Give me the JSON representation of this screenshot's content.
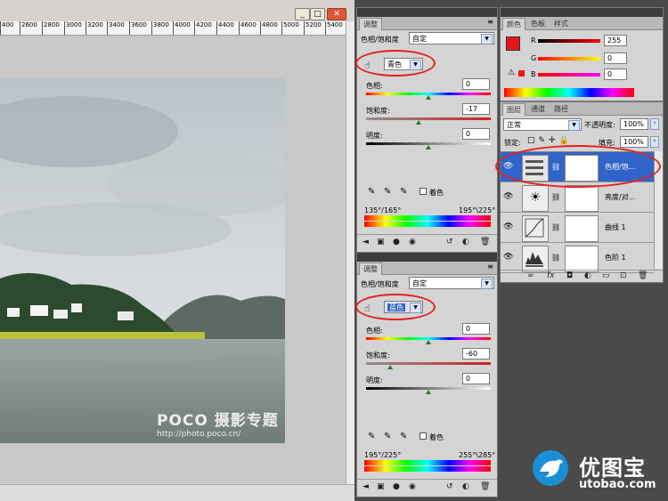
{
  "document": {
    "ruler_ticks": [
      "400",
      "2600",
      "2800",
      "3000",
      "3200",
      "3400",
      "3600",
      "3800",
      "4000",
      "4200",
      "4400",
      "4600",
      "4800",
      "5000",
      "5200",
      "5400"
    ],
    "window_buttons": [
      "_",
      "□",
      "✕"
    ],
    "watermark_brand": "POCO 摄影专题",
    "watermark_url": "http://photo.poco.cn/"
  },
  "adjust_panel_1": {
    "tab": "调整",
    "preset_label": "色相/饱和度",
    "preset_value": "自定",
    "channel": "青色",
    "hue_label": "色相:",
    "hue_value": "0",
    "sat_label": "饱和度:",
    "sat_value": "-17",
    "light_label": "明度:",
    "light_value": "0",
    "colorize_label": "着色",
    "range_left": "135°/165°",
    "range_right": "195°\\225°"
  },
  "adjust_panel_2": {
    "tab": "调整",
    "preset_label": "色相/饱和度",
    "preset_value": "自定",
    "channel": "蓝色",
    "hue_label": "色相:",
    "hue_value": "0",
    "sat_label": "饱和度:",
    "sat_value": "-60",
    "light_label": "明度:",
    "light_value": "0",
    "colorize_label": "着色",
    "range_left": "195°/225°",
    "range_right": "255°\\285°"
  },
  "color_panel": {
    "tabs": [
      "颜色",
      "色板",
      "样式"
    ],
    "r_label": "R",
    "r_value": "255",
    "g_label": "G",
    "g_value": "0",
    "b_label": "B",
    "b_value": "0",
    "foreground": "#e8161a"
  },
  "layers_panel": {
    "tabs": [
      "图层",
      "通道",
      "路径"
    ],
    "blend_mode": "正常",
    "opacity_label": "不透明度:",
    "opacity_value": "100%",
    "lock_label": "锁定:",
    "fill_label": "填充:",
    "fill_value": "100%",
    "layers": [
      {
        "name": "色相/饱...",
        "icon": "hue-saturation-icon",
        "selected": true
      },
      {
        "name": "亮度/对...",
        "icon": "brightness-contrast-icon",
        "selected": false
      },
      {
        "name": "曲线 1",
        "icon": "curves-icon",
        "selected": false
      },
      {
        "name": "色阶 1",
        "icon": "levels-icon",
        "selected": false
      }
    ],
    "footer_icons": [
      "link-icon",
      "fx-icon",
      "mask-icon",
      "adjustment-icon",
      "group-icon",
      "new-layer-icon",
      "trash-icon"
    ]
  },
  "site_logo": {
    "brand": "优图宝",
    "url": "utobao.com"
  },
  "accent_color": "#e8201c"
}
